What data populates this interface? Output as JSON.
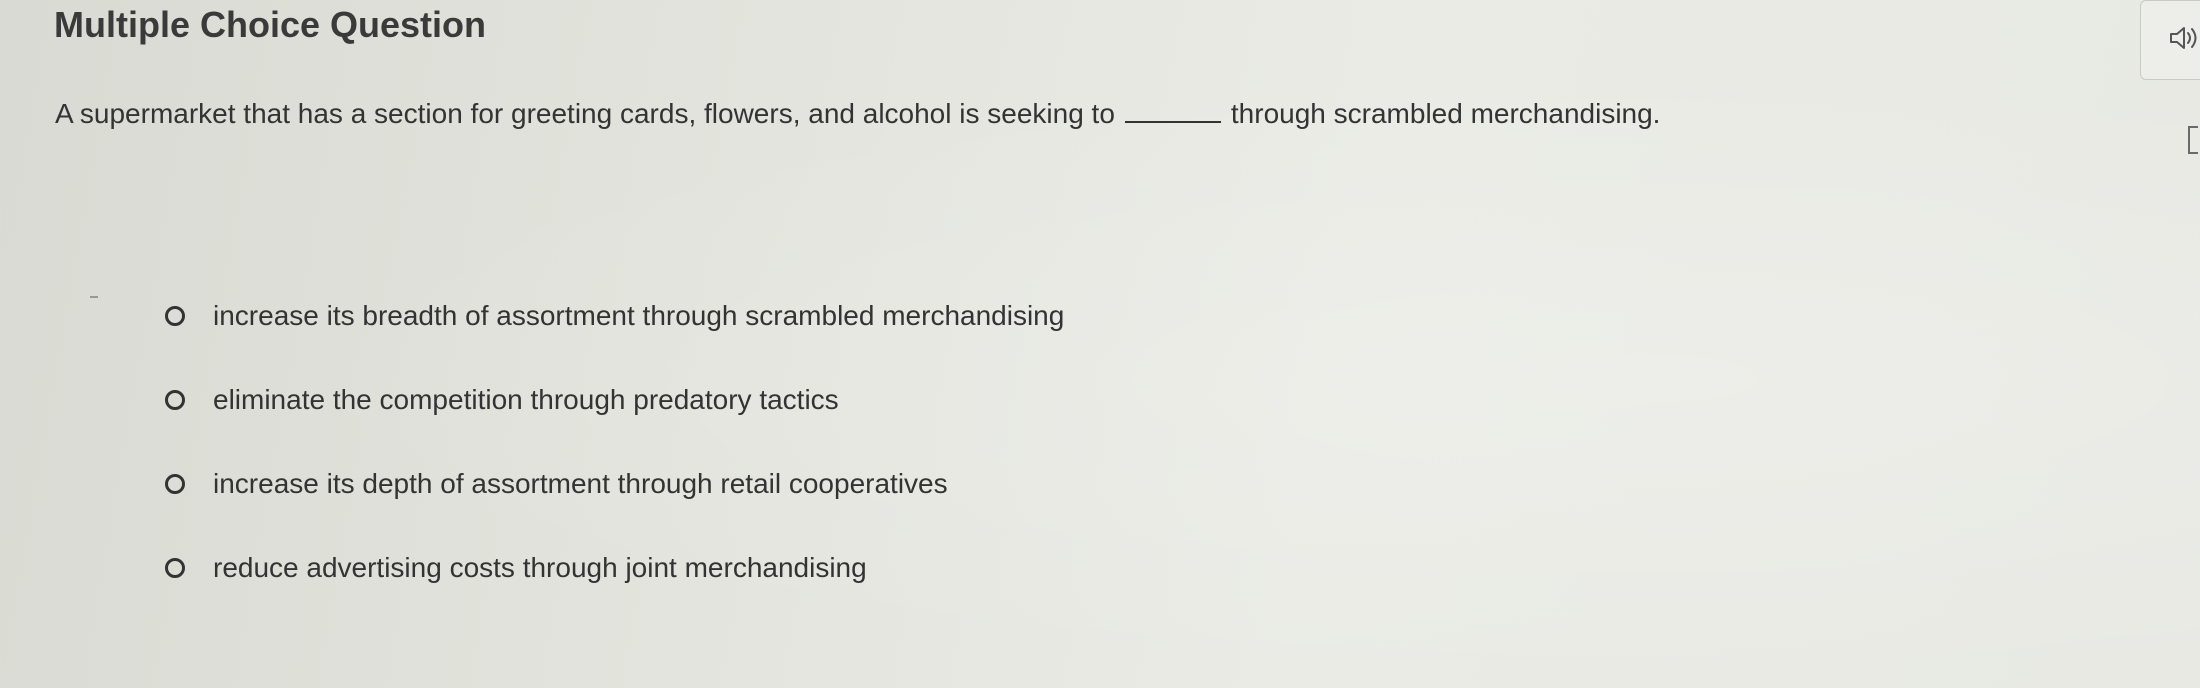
{
  "header": {
    "title": "Multiple Choice Question"
  },
  "question": {
    "text_before": "A supermarket that has a section for greeting cards, flowers, and alcohol is seeking to",
    "text_after": "through scrambled merchandising."
  },
  "options": [
    {
      "label": "increase its breadth of assortment through scrambled merchandising"
    },
    {
      "label": "eliminate the competition through predatory tactics"
    },
    {
      "label": "increase its depth of assortment through retail cooperatives"
    },
    {
      "label": "reduce advertising costs through joint merchandising"
    }
  ],
  "icons": {
    "audio": "speaker-icon"
  },
  "colors": {
    "text": "#333333",
    "background": "#e2e3dc"
  }
}
